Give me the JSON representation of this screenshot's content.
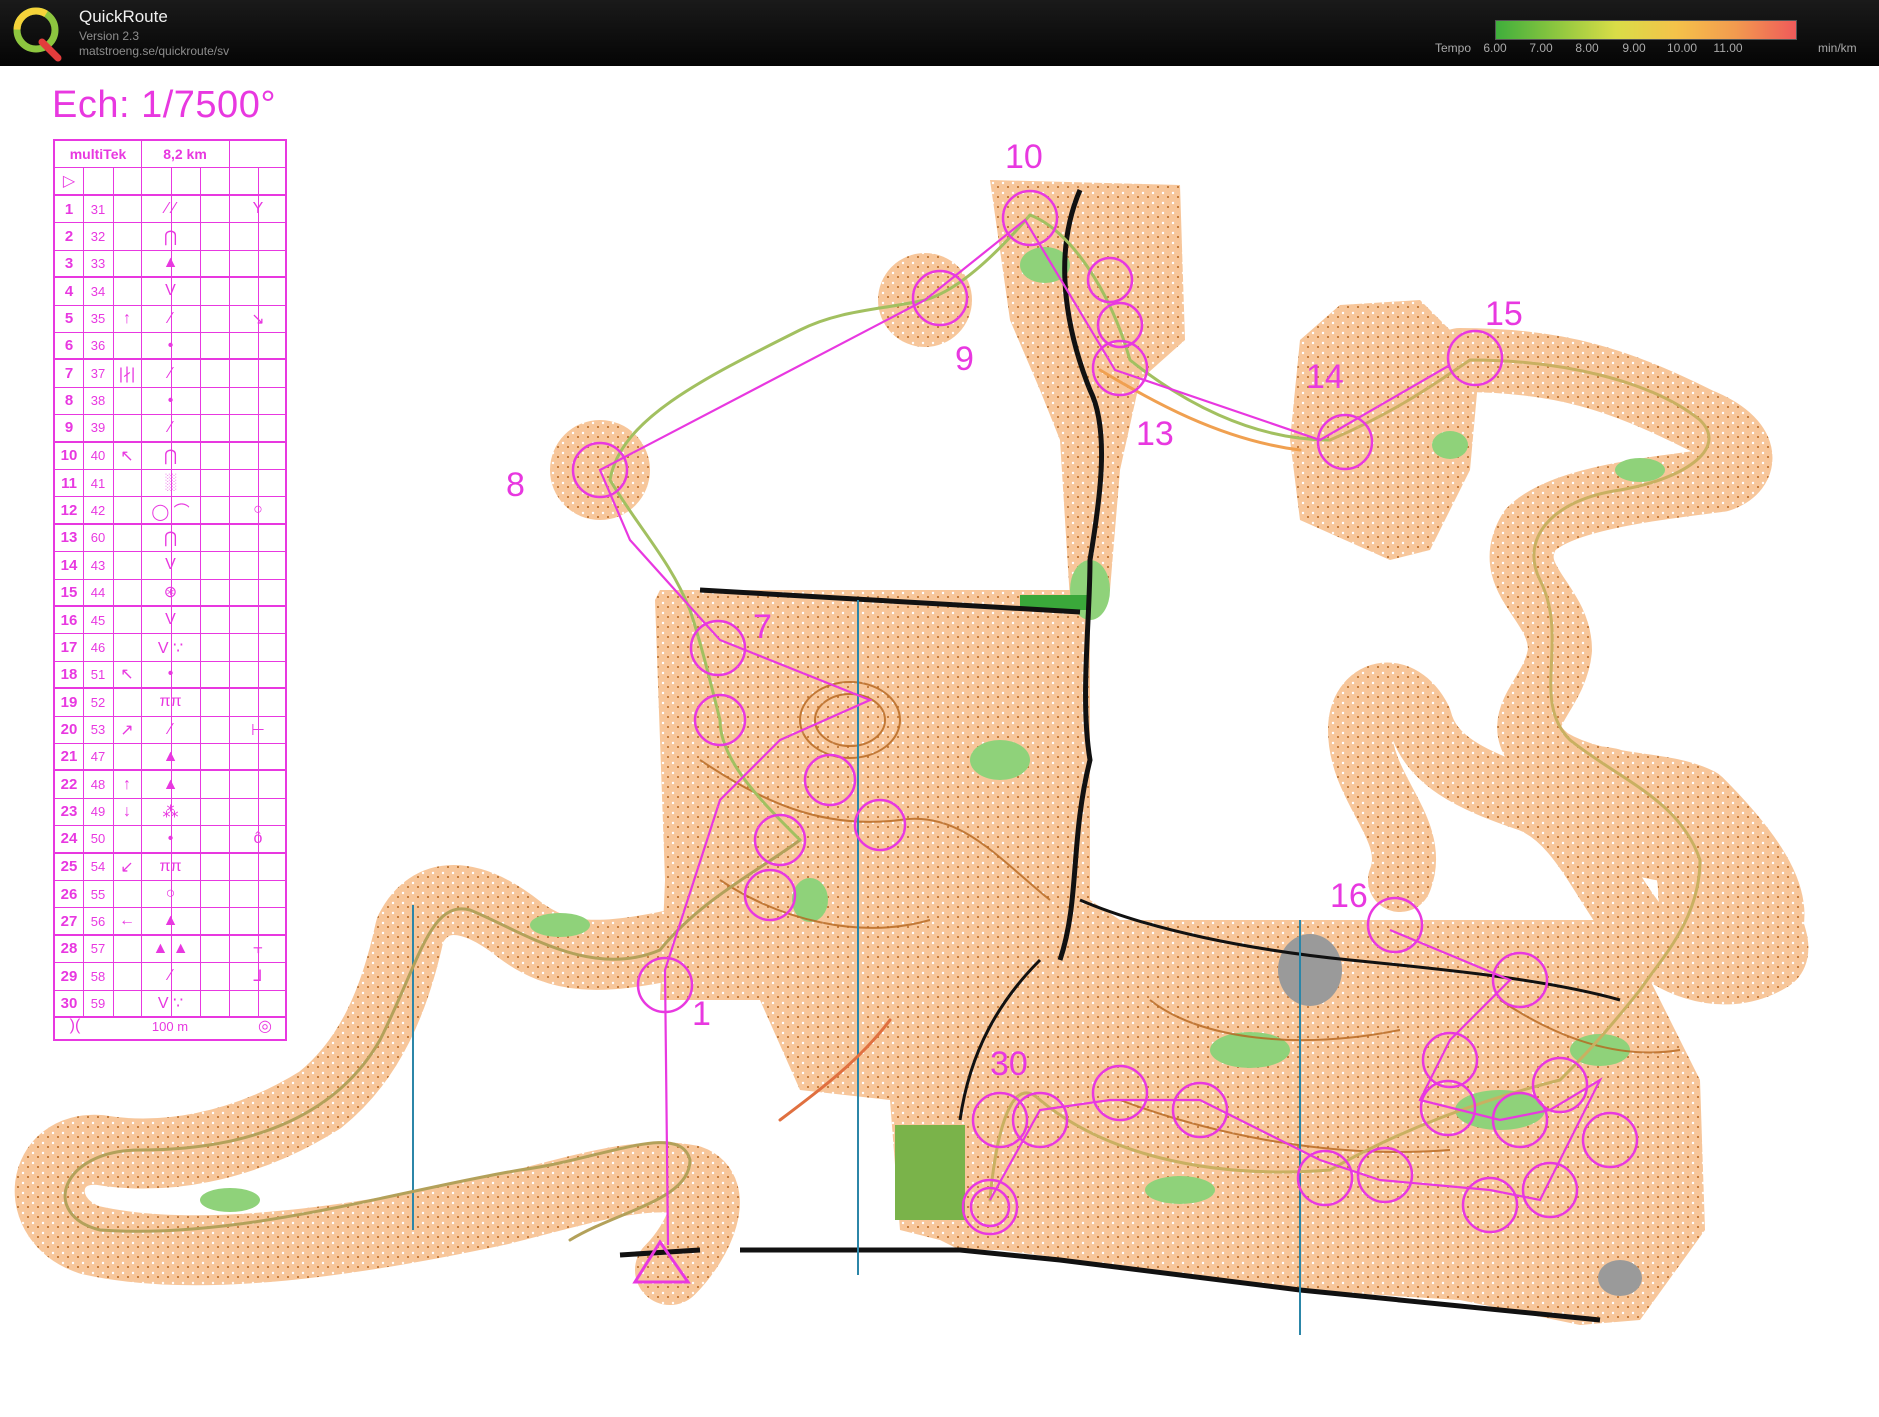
{
  "app": {
    "title": "QuickRoute",
    "version": "Version 2.3",
    "url": "matstroeng.se/quickroute/sv",
    "logo_letter": "Q"
  },
  "pace_legend": {
    "label": "Tempo",
    "ticks": [
      "6.00",
      "7.00",
      "8.00",
      "9.00",
      "10.00",
      "11.00"
    ],
    "unit": "min/km",
    "colors": [
      "#3fae3c",
      "#8cc63f",
      "#d9dd47",
      "#f4c24a",
      "#f39a4f",
      "#ee5a5a"
    ]
  },
  "map": {
    "scale": "Ech: 1/7500°",
    "colors": {
      "open_land": "#f7c69a",
      "forest_green": "#8fd27a",
      "course_magenta": "#e838e0",
      "route_line": "#a6a46a",
      "road_black": "#111111",
      "stream_blue": "#2c86a8"
    },
    "control_labels": [
      {
        "n": "1"
      },
      {
        "n": "7"
      },
      {
        "n": "8"
      },
      {
        "n": "9"
      },
      {
        "n": "10"
      },
      {
        "n": "13"
      },
      {
        "n": "14"
      },
      {
        "n": "15"
      },
      {
        "n": "16"
      },
      {
        "n": "30"
      }
    ]
  },
  "description_sheet": {
    "event": "multiTek",
    "length": "8,2 km",
    "start_symbol": "▷",
    "footer_distance": "100 m",
    "rows": [
      {
        "num": "1",
        "code": "31",
        "dir": "",
        "feature": "⁄ ⁄",
        "detail": "Y"
      },
      {
        "num": "2",
        "code": "32",
        "dir": "",
        "feature": "⋂",
        "detail": ""
      },
      {
        "num": "3",
        "code": "33",
        "dir": "",
        "feature": "▲",
        "detail": ""
      },
      {
        "num": "4",
        "code": "34",
        "dir": "",
        "feature": "V",
        "detail": ""
      },
      {
        "num": "5",
        "code": "35",
        "dir": "↑",
        "feature": "⁄",
        "detail": "↘"
      },
      {
        "num": "6",
        "code": "36",
        "dir": "",
        "feature": "•",
        "detail": ""
      },
      {
        "num": "7",
        "code": "37",
        "dir": "|∤|",
        "feature": "⁄",
        "detail": ""
      },
      {
        "num": "8",
        "code": "38",
        "dir": "",
        "feature": "•",
        "detail": ""
      },
      {
        "num": "9",
        "code": "39",
        "dir": "",
        "feature": "⁄",
        "detail": ""
      },
      {
        "num": "10",
        "code": "40",
        "dir": "↖",
        "feature": "⋂",
        "detail": ""
      },
      {
        "num": "11",
        "code": "41",
        "dir": "",
        "feature": "░",
        "detail": ""
      },
      {
        "num": "12",
        "code": "42",
        "dir": "",
        "feature": "◯ ⌒",
        "detail": "○"
      },
      {
        "num": "13",
        "code": "60",
        "dir": "",
        "feature": "⋂",
        "detail": ""
      },
      {
        "num": "14",
        "code": "43",
        "dir": "",
        "feature": "V",
        "detail": ""
      },
      {
        "num": "15",
        "code": "44",
        "dir": "",
        "feature": "⊛",
        "detail": ""
      },
      {
        "num": "16",
        "code": "45",
        "dir": "",
        "feature": "V",
        "detail": ""
      },
      {
        "num": "17",
        "code": "46",
        "dir": "",
        "feature": "V ∵",
        "detail": ""
      },
      {
        "num": "18",
        "code": "51",
        "dir": "↖",
        "feature": "•",
        "detail": ""
      },
      {
        "num": "19",
        "code": "52",
        "dir": "",
        "feature": "ππ",
        "detail": ""
      },
      {
        "num": "20",
        "code": "53",
        "dir": "↗",
        "feature": "⁄",
        "detail": "⊢"
      },
      {
        "num": "21",
        "code": "47",
        "dir": "",
        "feature": "▲",
        "detail": ""
      },
      {
        "num": "22",
        "code": "48",
        "dir": "↑",
        "feature": "▲",
        "detail": ""
      },
      {
        "num": "23",
        "code": "49",
        "dir": "↓",
        "feature": "⁂",
        "detail": ""
      },
      {
        "num": "24",
        "code": "50",
        "dir": "",
        "feature": "•",
        "detail": "ô"
      },
      {
        "num": "25",
        "code": "54",
        "dir": "↙",
        "feature": "ππ",
        "detail": ""
      },
      {
        "num": "26",
        "code": "55",
        "dir": "",
        "feature": "○",
        "detail": ""
      },
      {
        "num": "27",
        "code": "56",
        "dir": "←",
        "feature": "▲",
        "detail": ""
      },
      {
        "num": "28",
        "code": "57",
        "dir": "",
        "feature": "▲ ▲",
        "detail": "⫟"
      },
      {
        "num": "29",
        "code": "58",
        "dir": "",
        "feature": "⁄",
        "detail": "⅃"
      },
      {
        "num": "30",
        "code": "59",
        "dir": "",
        "feature": "V ∵",
        "detail": ""
      }
    ]
  }
}
